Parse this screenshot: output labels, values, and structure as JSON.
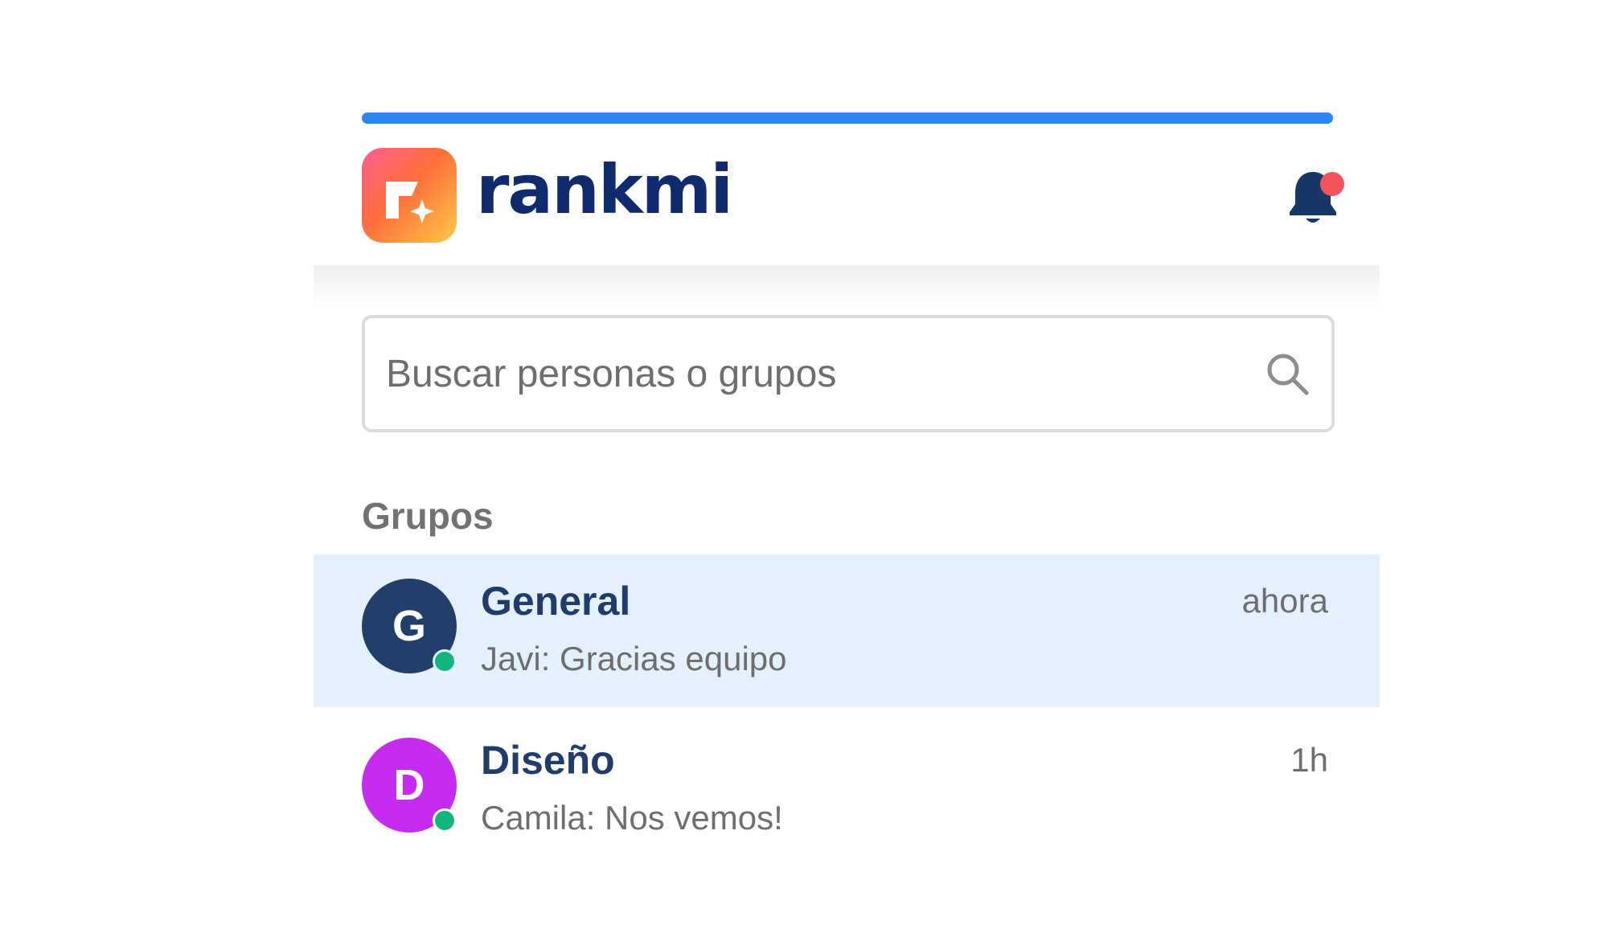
{
  "brand": {
    "name": "rankmi",
    "logo_icon": "rankmi-logo-icon",
    "accent_color": "#2c86f0",
    "wordmark_color": "#102a6e"
  },
  "header": {
    "notifications_icon": "bell-icon",
    "has_unread": true,
    "unread_dot_color": "#f2545b"
  },
  "search": {
    "placeholder": "Buscar personas o grupos",
    "value": "",
    "icon": "search-icon"
  },
  "groups_section": {
    "label": "Grupos",
    "items": [
      {
        "initial": "G",
        "name": "General",
        "time": "ahora",
        "preview": "Javi: Gracias equipo",
        "avatar_color": "#223e6a",
        "online": true,
        "selected": true
      },
      {
        "initial": "D",
        "name": "Diseño",
        "time": "1h",
        "preview": "Camila: Nos vemos!",
        "avatar_color": "#c62cf0",
        "online": true,
        "selected": false
      }
    ]
  },
  "colors": {
    "selected_row_bg": "#e4f1fd",
    "online_status": "#13b57e",
    "group_name": "#1f3c6b",
    "secondary_text": "#6e6e6e"
  }
}
